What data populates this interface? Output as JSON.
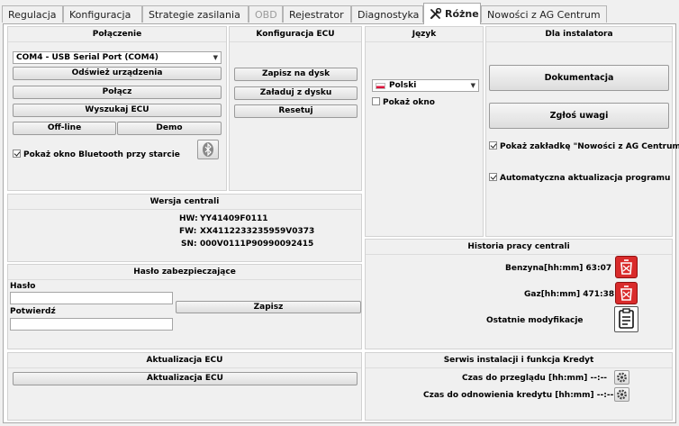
{
  "tabs": [
    {
      "label": "Regulacja",
      "state": "normal"
    },
    {
      "label": "Konfiguracja",
      "state": "normal"
    },
    {
      "label": "Strategie zasilania",
      "state": "normal"
    },
    {
      "label": "OBD",
      "state": "disabled"
    },
    {
      "label": "Rejestrator",
      "state": "normal"
    },
    {
      "label": "Diagnostyka",
      "state": "normal"
    },
    {
      "label": "Różne",
      "state": "active",
      "icon": "tools-icon"
    },
    {
      "label": "Nowości z AG Centrum",
      "state": "normal"
    }
  ],
  "connection": {
    "title": "Połączenie",
    "port_value": "COM4 - USB Serial Port (COM4)",
    "refresh_label": "Odśwież urządzenia",
    "connect_label": "Połącz",
    "search_label": "Wyszukaj ECU",
    "offline_label": "Off-line",
    "demo_label": "Demo",
    "bluetooth_checkbox_label": "Pokaż okno Bluetooth przy starcie",
    "bluetooth_checked": true,
    "bluetooth_icon": "bluetooth-icon"
  },
  "ecu_config": {
    "title": "Konfiguracja ECU",
    "save_label": "Zapisz na dysk",
    "load_label": "Załaduj z dysku",
    "reset_label": "Resetuj"
  },
  "language": {
    "title": "Język",
    "selected": "Polski",
    "flag_icon": "poland-flag-icon",
    "show_window_label": "Pokaż okno",
    "show_window_checked": false
  },
  "installer": {
    "title": "Dla instalatora",
    "docs_label": "Dokumentacja",
    "report_label": "Zgłoś uwagi",
    "show_news_tab_label": "Pokaż zakładkę \"Nowości z AG Centrum\"",
    "show_news_tab_checked": true,
    "auto_update_label": "Automatyczna aktualizacja programu",
    "auto_update_checked": true
  },
  "version": {
    "title": "Wersja centrali",
    "hw_label": "HW:",
    "hw_value": "YY41409F0111",
    "fw_label": "FW:",
    "fw_value": "XX4112233235959V0373",
    "sn_label": "SN:",
    "sn_value": "000V0111P90990092415"
  },
  "history": {
    "title": "Historia pracy centrali",
    "petrol_label": "Benzyna[hh:mm] 63:07",
    "gas_label": "Gaz[hh:mm] 471:38",
    "last_mod_label": "Ostatnie modyfikacje",
    "clear_icon": "trash-clear-icon",
    "list_icon": "clipboard-list-icon"
  },
  "password": {
    "title": "Hasło zabezpieczające",
    "password_label": "Hasło",
    "password_value": "",
    "confirm_label": "Potwierdź",
    "confirm_value": "",
    "save_label": "Zapisz"
  },
  "update": {
    "title": "Aktualizacja ECU",
    "button_label": "Aktualizacja ECU"
  },
  "service": {
    "title": "Serwis instalacji i funkcja Kredyt",
    "inspection_label": "Czas do przeglądu [hh:mm] --:--",
    "credit_label": "Czas do odnowienia kredytu [hh:mm] --:--",
    "gear_icon": "gear-icon"
  },
  "colors": {
    "red_button": "#d92b2b",
    "panel_bg": "#f0f0f0",
    "flag_red": "#dc143c"
  }
}
